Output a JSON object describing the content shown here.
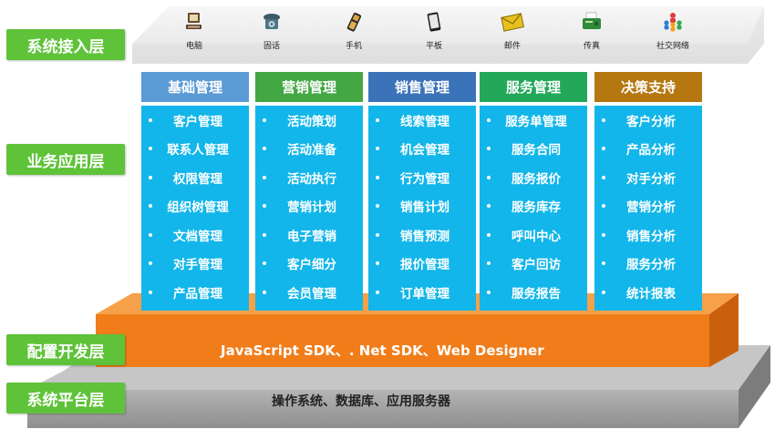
{
  "layers": {
    "access": "系统接入层",
    "business": "业务应用层",
    "config": "配置开发层",
    "platform": "系统平台层"
  },
  "access_items": [
    {
      "label": "电脑",
      "icon": "computer-icon"
    },
    {
      "label": "固话",
      "icon": "telephone-icon"
    },
    {
      "label": "手机",
      "icon": "mobile-phone-icon"
    },
    {
      "label": "平板",
      "icon": "tablet-icon"
    },
    {
      "label": "邮件",
      "icon": "mail-icon"
    },
    {
      "label": "传真",
      "icon": "fax-icon"
    },
    {
      "label": "社交网络",
      "icon": "social-network-icon"
    }
  ],
  "modules": [
    {
      "title": "基础管理",
      "color": "#5b9bd5",
      "items": [
        "客户管理",
        "联系人管理",
        "权限管理",
        "组织树管理",
        "文档管理",
        "对手管理",
        "产品管理"
      ]
    },
    {
      "title": "营销管理",
      "color": "#43a843",
      "items": [
        "活动策划",
        "活动准备",
        "活动执行",
        "营销计划",
        "电子营销",
        "客户细分",
        "会员管理"
      ]
    },
    {
      "title": "销售管理",
      "color": "#3b73b9",
      "items": [
        "线索管理",
        "机会管理",
        "行为管理",
        "销售计划",
        "销售预测",
        "报价管理",
        "订单管理"
      ]
    },
    {
      "title": "服务管理",
      "color": "#23a85a",
      "items": [
        "服务单管理",
        "服务合同",
        "服务报价",
        "服务库存",
        "呼叫中心",
        "客户回访",
        "服务报告"
      ]
    },
    {
      "title": "决策支持",
      "color": "#b5770f",
      "items": [
        "客户分析",
        "产品分析",
        "对手分析",
        "营销分析",
        "销售分析",
        "服务分析",
        "统计报表"
      ]
    }
  ],
  "config_text": "JavaScript SDK、. Net SDK、Web Designer",
  "platform_text": "操作系统、数据库、应用服务器",
  "colors": {
    "layer_label": "#5fc33a",
    "module_body": "#12b6ea",
    "config_slab": "#f07d1a",
    "platform_slab": "#9a9a9a"
  }
}
